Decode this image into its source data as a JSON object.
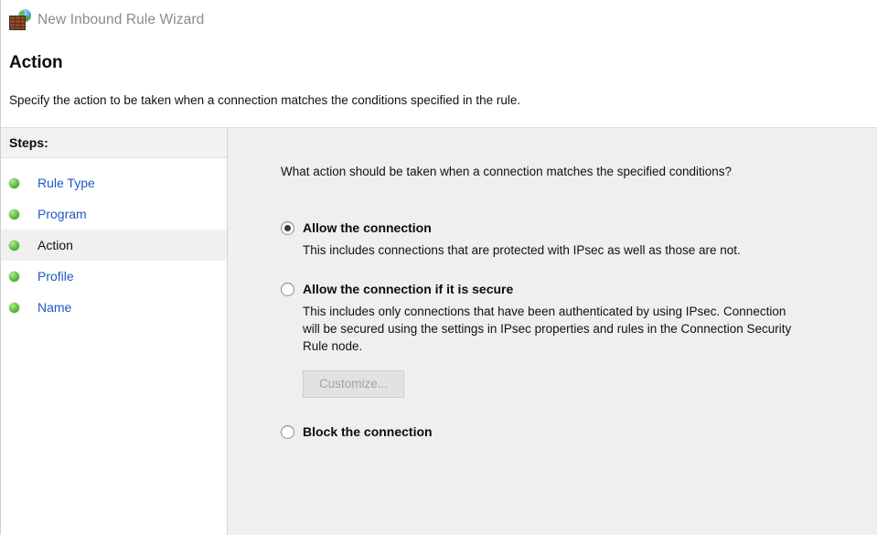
{
  "window": {
    "title": "New Inbound Rule Wizard",
    "title_icon": "firewall-wall-globe-icon"
  },
  "header": {
    "page_title": "Action",
    "page_subtitle": "Specify the action to be taken when a connection matches the conditions specified in the rule."
  },
  "sidebar": {
    "heading": "Steps:",
    "items": [
      {
        "label": "Rule Type",
        "bullet": "green-sphere-icon",
        "current": false
      },
      {
        "label": "Program",
        "bullet": "green-sphere-icon",
        "current": false
      },
      {
        "label": "Action",
        "bullet": "green-sphere-icon",
        "current": true
      },
      {
        "label": "Profile",
        "bullet": "green-sphere-icon",
        "current": false
      },
      {
        "label": "Name",
        "bullet": "green-sphere-icon",
        "current": false
      }
    ]
  },
  "main": {
    "question": "What action should be taken when a connection matches the specified conditions?",
    "options": [
      {
        "id": "allow",
        "label": "Allow the connection",
        "selected": true,
        "description_lines": [
          "This includes connections that are protected with IPsec as well as those are not."
        ]
      },
      {
        "id": "allow-if-secure",
        "label": "Allow the connection if it is secure",
        "selected": false,
        "description_lines": [
          "This includes only connections that have been authenticated by using IPsec.  Connection",
          "will be secured using the settings in IPsec properties and rules in the Connection Security",
          "Rule node."
        ],
        "button": {
          "label": "Customize...",
          "enabled": false
        }
      },
      {
        "id": "block",
        "label": "Block the connection",
        "selected": false,
        "description_lines": []
      }
    ]
  },
  "colors": {
    "link": "#1f57c3",
    "bullet_green": "#4daf36",
    "panel_background": "#efefef",
    "sidebar_background": "#ffffff",
    "title_text": "#8a8a8a",
    "disabled_text": "#a3a3a3"
  }
}
